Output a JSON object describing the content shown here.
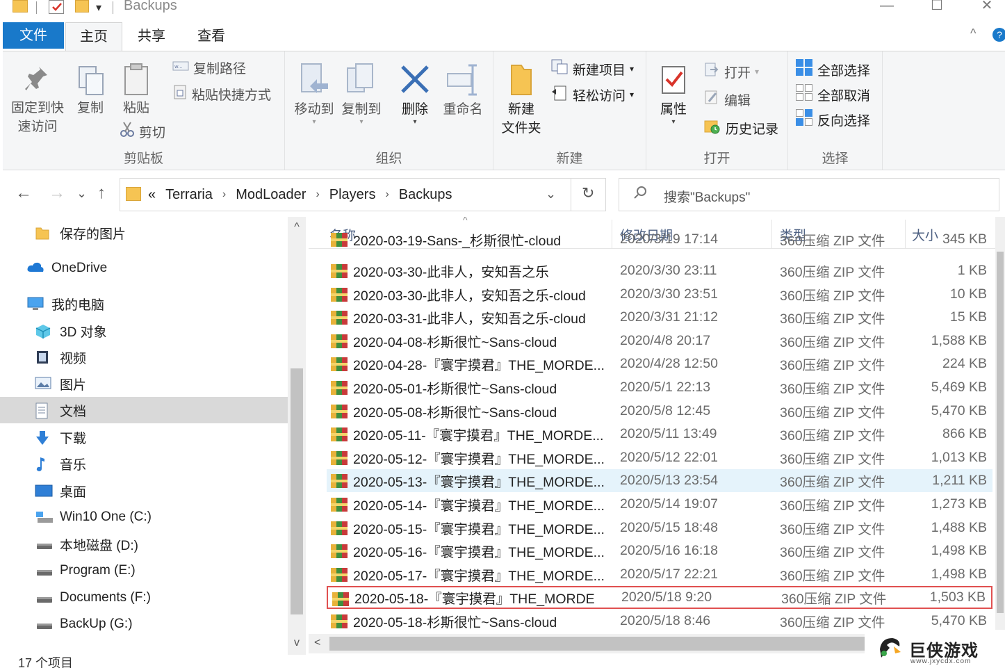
{
  "window": {
    "title": "Backups",
    "minimize": "—",
    "maximize": "☐",
    "close": "✕",
    "quick_access_dropdown": "▾"
  },
  "ribbon_tabs": {
    "file": "文件",
    "home": "主页",
    "share": "共享",
    "view": "查看",
    "collapse": "^",
    "help": "?"
  },
  "ribbon": {
    "clipboard": {
      "label": "剪贴板",
      "pin_line1": "固定到快",
      "pin_line2": "速访问",
      "copy": "复制",
      "paste": "粘贴",
      "copy_path": "复制路径",
      "paste_shortcut": "粘贴快捷方式",
      "cut": "剪切"
    },
    "organize": {
      "label": "组织",
      "move_to": "移动到",
      "copy_to": "复制到",
      "delete": "删除",
      "rename": "重命名"
    },
    "new": {
      "label": "新建",
      "new_folder_line1": "新建",
      "new_folder_line2": "文件夹",
      "new_item": "新建项目",
      "easy_access": "轻松访问"
    },
    "open": {
      "label": "打开",
      "properties": "属性",
      "open": "打开",
      "edit": "编辑",
      "history": "历史记录"
    },
    "select": {
      "label": "选择",
      "select_all": "全部选择",
      "select_none": "全部取消",
      "invert": "反向选择"
    }
  },
  "address": {
    "overflow": "«",
    "crumbs": [
      "Terraria",
      "ModLoader",
      "Players",
      "Backups"
    ],
    "search_placeholder": "搜索\"Backups\""
  },
  "nav": {
    "back": "←",
    "forward": "→",
    "recent": "⌄",
    "up": "↑",
    "refresh": "↻",
    "dropdown": "⌄"
  },
  "sidebar": {
    "items": [
      {
        "label": "保存的图片",
        "icon": "folder-icon"
      },
      {
        "label": "OneDrive",
        "icon": "cloud-icon"
      },
      {
        "label": "我的电脑",
        "icon": "computer-icon"
      },
      {
        "label": "3D 对象",
        "icon": "cube-icon"
      },
      {
        "label": "视频",
        "icon": "video-icon"
      },
      {
        "label": "图片",
        "icon": "picture-icon"
      },
      {
        "label": "文档",
        "icon": "document-icon",
        "selected": true
      },
      {
        "label": "下载",
        "icon": "download-icon"
      },
      {
        "label": "音乐",
        "icon": "music-icon"
      },
      {
        "label": "桌面",
        "icon": "desktop-icon"
      },
      {
        "label": "Win10 One (C:)",
        "icon": "system-drive-icon"
      },
      {
        "label": "本地磁盘 (D:)",
        "icon": "drive-icon"
      },
      {
        "label": "Program (E:)",
        "icon": "drive-icon"
      },
      {
        "label": "Documents (F:)",
        "icon": "drive-icon"
      },
      {
        "label": "BackUp (G:)",
        "icon": "drive-icon"
      }
    ]
  },
  "filelist": {
    "columns": {
      "name": "名称",
      "date": "修改日期",
      "type": "类型",
      "size": "大小"
    },
    "partial_row": {
      "name": "2020-03-19-Sans-_杉斯很忙-cloud",
      "date": "2020/3/19 17:14",
      "type": "360压缩 ZIP 文件",
      "size": "345 KB"
    },
    "rows": [
      {
        "name": "2020-03-30-此非人，安知吾之乐",
        "date": "2020/3/30 23:11",
        "type": "360压缩 ZIP 文件",
        "size": "1 KB"
      },
      {
        "name": "2020-03-30-此非人，安知吾之乐-cloud",
        "date": "2020/3/30 23:51",
        "type": "360压缩 ZIP 文件",
        "size": "10 KB"
      },
      {
        "name": "2020-03-31-此非人，安知吾之乐-cloud",
        "date": "2020/3/31 21:12",
        "type": "360压缩 ZIP 文件",
        "size": "15 KB"
      },
      {
        "name": "2020-04-08-杉斯很忙~Sans-cloud",
        "date": "2020/4/8 20:17",
        "type": "360压缩 ZIP 文件",
        "size": "1,588 KB"
      },
      {
        "name": "2020-04-28-『寰宇摸君』THE_MORDE...",
        "date": "2020/4/28 12:50",
        "type": "360压缩 ZIP 文件",
        "size": "224 KB"
      },
      {
        "name": "2020-05-01-杉斯很忙~Sans-cloud",
        "date": "2020/5/1 22:13",
        "type": "360压缩 ZIP 文件",
        "size": "5,469 KB"
      },
      {
        "name": "2020-05-08-杉斯很忙~Sans-cloud",
        "date": "2020/5/8 12:45",
        "type": "360压缩 ZIP 文件",
        "size": "5,470 KB"
      },
      {
        "name": "2020-05-11-『寰宇摸君』THE_MORDE...",
        "date": "2020/5/11 13:49",
        "type": "360压缩 ZIP 文件",
        "size": "866 KB"
      },
      {
        "name": "2020-05-12-『寰宇摸君』THE_MORDE...",
        "date": "2020/5/12 22:01",
        "type": "360压缩 ZIP 文件",
        "size": "1,013 KB"
      },
      {
        "name": "2020-05-13-『寰宇摸君』THE_MORDE...",
        "date": "2020/5/13 23:54",
        "type": "360压缩 ZIP 文件",
        "size": "1,211 KB",
        "highlight": true
      },
      {
        "name": "2020-05-14-『寰宇摸君』THE_MORDE...",
        "date": "2020/5/14 19:07",
        "type": "360压缩 ZIP 文件",
        "size": "1,273 KB"
      },
      {
        "name": "2020-05-15-『寰宇摸君』THE_MORDE...",
        "date": "2020/5/15 18:48",
        "type": "360压缩 ZIP 文件",
        "size": "1,488 KB"
      },
      {
        "name": "2020-05-16-『寰宇摸君』THE_MORDE...",
        "date": "2020/5/16 16:18",
        "type": "360压缩 ZIP 文件",
        "size": "1,498 KB"
      },
      {
        "name": "2020-05-17-『寰宇摸君』THE_MORDE...",
        "date": "2020/5/17 22:21",
        "type": "360压缩 ZIP 文件",
        "size": "1,498 KB"
      },
      {
        "name": "2020-05-18-『寰宇摸君』THE_MORDE",
        "date": "2020/5/18 9:20",
        "type": "360压缩 ZIP 文件",
        "size": "1,503 KB",
        "boxed": true
      },
      {
        "name": "2020-05-18-杉斯很忙~Sans-cloud",
        "date": "2020/5/18 8:46",
        "type": "360压缩 ZIP 文件",
        "size": "5,470 KB"
      }
    ]
  },
  "status": {
    "item_count": "17 个项目"
  },
  "watermark": {
    "title": "巨侠游戏",
    "url": "www.jxycdx.com"
  },
  "colors": {
    "accent": "#1979ca",
    "selection": "#d9d9d9",
    "row_highlight": "#e5f3fb",
    "red_box": "#e05050"
  }
}
